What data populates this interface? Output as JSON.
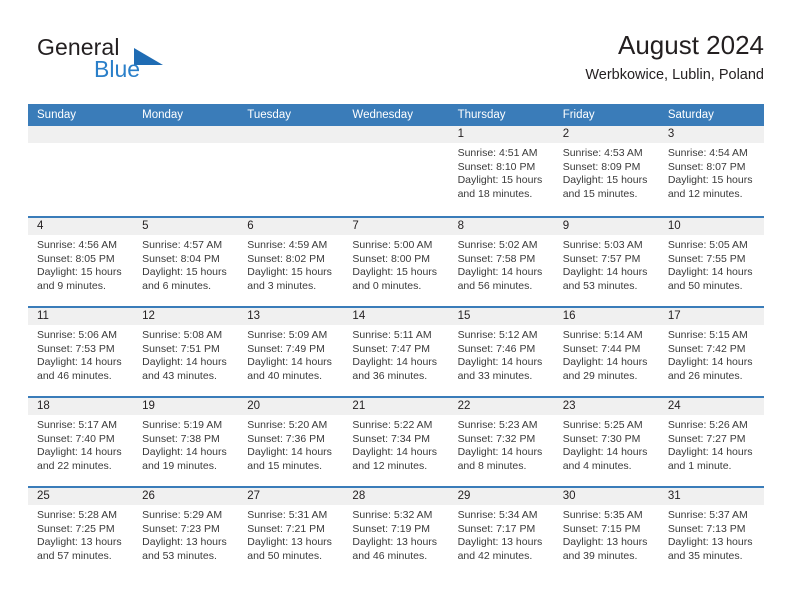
{
  "brand": {
    "word1": "General",
    "word2": "Blue",
    "logo_icon": "triangle-logo-icon",
    "accent_color": "#2a7fc9"
  },
  "header": {
    "title": "August 2024",
    "subtitle": "Werbkowice, Lublin, Poland"
  },
  "theme": {
    "header_blue": "#3a7cb9",
    "daynum_band": "#f0f0f0",
    "text": "#231f20"
  },
  "calendar": {
    "weekday_headers": [
      "Sunday",
      "Monday",
      "Tuesday",
      "Wednesday",
      "Thursday",
      "Friday",
      "Saturday"
    ],
    "weeks": [
      [
        {
          "day": "",
          "lines": []
        },
        {
          "day": "",
          "lines": []
        },
        {
          "day": "",
          "lines": []
        },
        {
          "day": "",
          "lines": []
        },
        {
          "day": "1",
          "lines": [
            "Sunrise: 4:51 AM",
            "Sunset: 8:10 PM",
            "Daylight: 15 hours",
            "and 18 minutes."
          ]
        },
        {
          "day": "2",
          "lines": [
            "Sunrise: 4:53 AM",
            "Sunset: 8:09 PM",
            "Daylight: 15 hours",
            "and 15 minutes."
          ]
        },
        {
          "day": "3",
          "lines": [
            "Sunrise: 4:54 AM",
            "Sunset: 8:07 PM",
            "Daylight: 15 hours",
            "and 12 minutes."
          ]
        }
      ],
      [
        {
          "day": "4",
          "lines": [
            "Sunrise: 4:56 AM",
            "Sunset: 8:05 PM",
            "Daylight: 15 hours",
            "and 9 minutes."
          ]
        },
        {
          "day": "5",
          "lines": [
            "Sunrise: 4:57 AM",
            "Sunset: 8:04 PM",
            "Daylight: 15 hours",
            "and 6 minutes."
          ]
        },
        {
          "day": "6",
          "lines": [
            "Sunrise: 4:59 AM",
            "Sunset: 8:02 PM",
            "Daylight: 15 hours",
            "and 3 minutes."
          ]
        },
        {
          "day": "7",
          "lines": [
            "Sunrise: 5:00 AM",
            "Sunset: 8:00 PM",
            "Daylight: 15 hours",
            "and 0 minutes."
          ]
        },
        {
          "day": "8",
          "lines": [
            "Sunrise: 5:02 AM",
            "Sunset: 7:58 PM",
            "Daylight: 14 hours",
            "and 56 minutes."
          ]
        },
        {
          "day": "9",
          "lines": [
            "Sunrise: 5:03 AM",
            "Sunset: 7:57 PM",
            "Daylight: 14 hours",
            "and 53 minutes."
          ]
        },
        {
          "day": "10",
          "lines": [
            "Sunrise: 5:05 AM",
            "Sunset: 7:55 PM",
            "Daylight: 14 hours",
            "and 50 minutes."
          ]
        }
      ],
      [
        {
          "day": "11",
          "lines": [
            "Sunrise: 5:06 AM",
            "Sunset: 7:53 PM",
            "Daylight: 14 hours",
            "and 46 minutes."
          ]
        },
        {
          "day": "12",
          "lines": [
            "Sunrise: 5:08 AM",
            "Sunset: 7:51 PM",
            "Daylight: 14 hours",
            "and 43 minutes."
          ]
        },
        {
          "day": "13",
          "lines": [
            "Sunrise: 5:09 AM",
            "Sunset: 7:49 PM",
            "Daylight: 14 hours",
            "and 40 minutes."
          ]
        },
        {
          "day": "14",
          "lines": [
            "Sunrise: 5:11 AM",
            "Sunset: 7:47 PM",
            "Daylight: 14 hours",
            "and 36 minutes."
          ]
        },
        {
          "day": "15",
          "lines": [
            "Sunrise: 5:12 AM",
            "Sunset: 7:46 PM",
            "Daylight: 14 hours",
            "and 33 minutes."
          ]
        },
        {
          "day": "16",
          "lines": [
            "Sunrise: 5:14 AM",
            "Sunset: 7:44 PM",
            "Daylight: 14 hours",
            "and 29 minutes."
          ]
        },
        {
          "day": "17",
          "lines": [
            "Sunrise: 5:15 AM",
            "Sunset: 7:42 PM",
            "Daylight: 14 hours",
            "and 26 minutes."
          ]
        }
      ],
      [
        {
          "day": "18",
          "lines": [
            "Sunrise: 5:17 AM",
            "Sunset: 7:40 PM",
            "Daylight: 14 hours",
            "and 22 minutes."
          ]
        },
        {
          "day": "19",
          "lines": [
            "Sunrise: 5:19 AM",
            "Sunset: 7:38 PM",
            "Daylight: 14 hours",
            "and 19 minutes."
          ]
        },
        {
          "day": "20",
          "lines": [
            "Sunrise: 5:20 AM",
            "Sunset: 7:36 PM",
            "Daylight: 14 hours",
            "and 15 minutes."
          ]
        },
        {
          "day": "21",
          "lines": [
            "Sunrise: 5:22 AM",
            "Sunset: 7:34 PM",
            "Daylight: 14 hours",
            "and 12 minutes."
          ]
        },
        {
          "day": "22",
          "lines": [
            "Sunrise: 5:23 AM",
            "Sunset: 7:32 PM",
            "Daylight: 14 hours",
            "and 8 minutes."
          ]
        },
        {
          "day": "23",
          "lines": [
            "Sunrise: 5:25 AM",
            "Sunset: 7:30 PM",
            "Daylight: 14 hours",
            "and 4 minutes."
          ]
        },
        {
          "day": "24",
          "lines": [
            "Sunrise: 5:26 AM",
            "Sunset: 7:27 PM",
            "Daylight: 14 hours",
            "and 1 minute."
          ]
        }
      ],
      [
        {
          "day": "25",
          "lines": [
            "Sunrise: 5:28 AM",
            "Sunset: 7:25 PM",
            "Daylight: 13 hours",
            "and 57 minutes."
          ]
        },
        {
          "day": "26",
          "lines": [
            "Sunrise: 5:29 AM",
            "Sunset: 7:23 PM",
            "Daylight: 13 hours",
            "and 53 minutes."
          ]
        },
        {
          "day": "27",
          "lines": [
            "Sunrise: 5:31 AM",
            "Sunset: 7:21 PM",
            "Daylight: 13 hours",
            "and 50 minutes."
          ]
        },
        {
          "day": "28",
          "lines": [
            "Sunrise: 5:32 AM",
            "Sunset: 7:19 PM",
            "Daylight: 13 hours",
            "and 46 minutes."
          ]
        },
        {
          "day": "29",
          "lines": [
            "Sunrise: 5:34 AM",
            "Sunset: 7:17 PM",
            "Daylight: 13 hours",
            "and 42 minutes."
          ]
        },
        {
          "day": "30",
          "lines": [
            "Sunrise: 5:35 AM",
            "Sunset: 7:15 PM",
            "Daylight: 13 hours",
            "and 39 minutes."
          ]
        },
        {
          "day": "31",
          "lines": [
            "Sunrise: 5:37 AM",
            "Sunset: 7:13 PM",
            "Daylight: 13 hours",
            "and 35 minutes."
          ]
        }
      ]
    ]
  }
}
